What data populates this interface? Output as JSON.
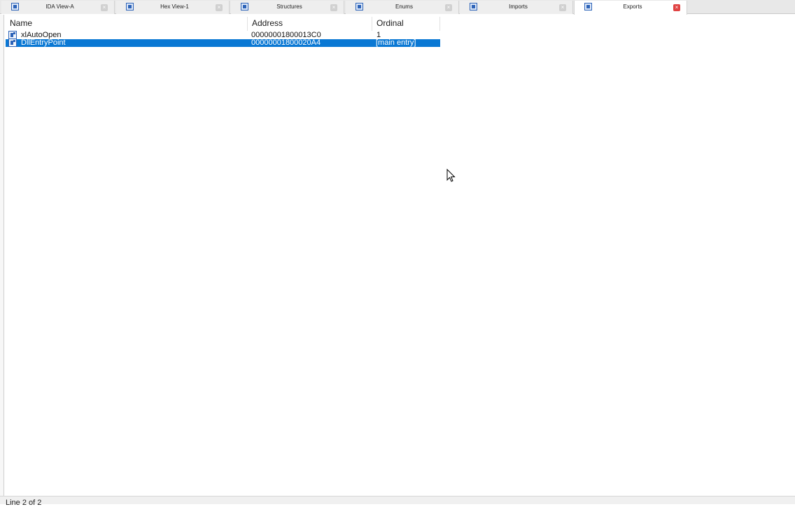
{
  "tabs": [
    {
      "label": "IDA View-A",
      "icon": "ida-view-icon"
    },
    {
      "label": "Hex View-1",
      "icon": "hex-view-icon"
    },
    {
      "label": "Structures",
      "icon": "structures-icon"
    },
    {
      "label": "Enums",
      "icon": "enums-icon"
    },
    {
      "label": "Imports",
      "icon": "imports-icon"
    },
    {
      "label": "Exports",
      "icon": "exports-icon",
      "active": true
    }
  ],
  "close_glyph": "×",
  "colors": {
    "selection": "#0a78d4",
    "active_close": "#e04343",
    "icon_blue": "#2d63b8"
  },
  "table": {
    "columns": [
      "Name",
      "Address",
      "Ordinal"
    ],
    "rows": [
      {
        "name": "xlAutoOpen",
        "address": "00000001800013C0",
        "ordinal": "1",
        "selected": false
      },
      {
        "name": "DllEntryPoint",
        "address": "00000001800020A4",
        "ordinal": "[main entry]",
        "selected": true
      }
    ]
  },
  "status": {
    "text": "Line 2 of 2"
  }
}
